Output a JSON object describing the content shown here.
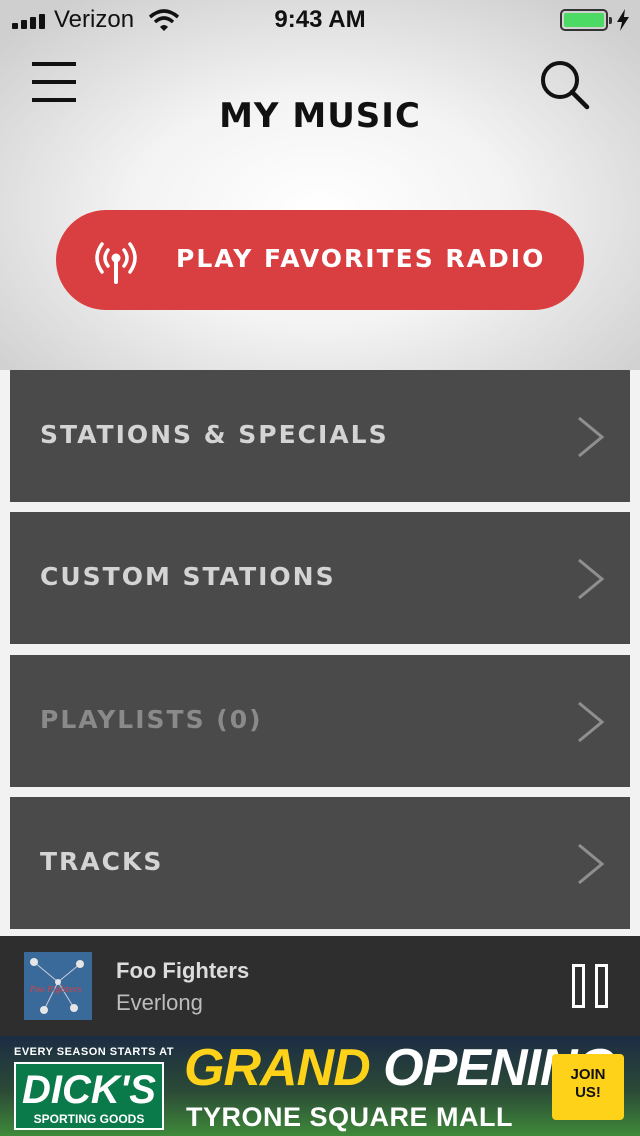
{
  "status_bar": {
    "carrier": "Verizon",
    "time": "9:43 AM",
    "battery_color": "#4cd964"
  },
  "header": {
    "title": "MY MUSIC",
    "menu_icon": "hamburger-menu-icon",
    "search_icon": "search-icon"
  },
  "play_favorites": {
    "label": "PLAY FAVORITES RADIO",
    "icon": "radio-broadcast-icon",
    "color": "#d93f40"
  },
  "menu": {
    "items": [
      {
        "label": "STATIONS & SPECIALS",
        "enabled": true
      },
      {
        "label": "CUSTOM STATIONS",
        "enabled": true
      },
      {
        "label": "PLAYLISTS (0)",
        "enabled": false
      },
      {
        "label": "TRACKS",
        "enabled": true
      }
    ],
    "chevron_icon": "chevron-right-icon"
  },
  "now_playing": {
    "artist": "Foo Fighters",
    "track": "Everlong",
    "album_art_text": "Foo Fighters",
    "control_icon": "pause-icon"
  },
  "ad": {
    "tagline": "EVERY SEASON STARTS AT",
    "logo": "DICK'S",
    "logo_sub": "SPORTING GOODS",
    "headline_1": "GRAND",
    "headline_2": "OPENING",
    "subline": "TYRONE SQUARE MALL",
    "cta_line_1": "JOIN",
    "cta_line_2": "US!"
  }
}
